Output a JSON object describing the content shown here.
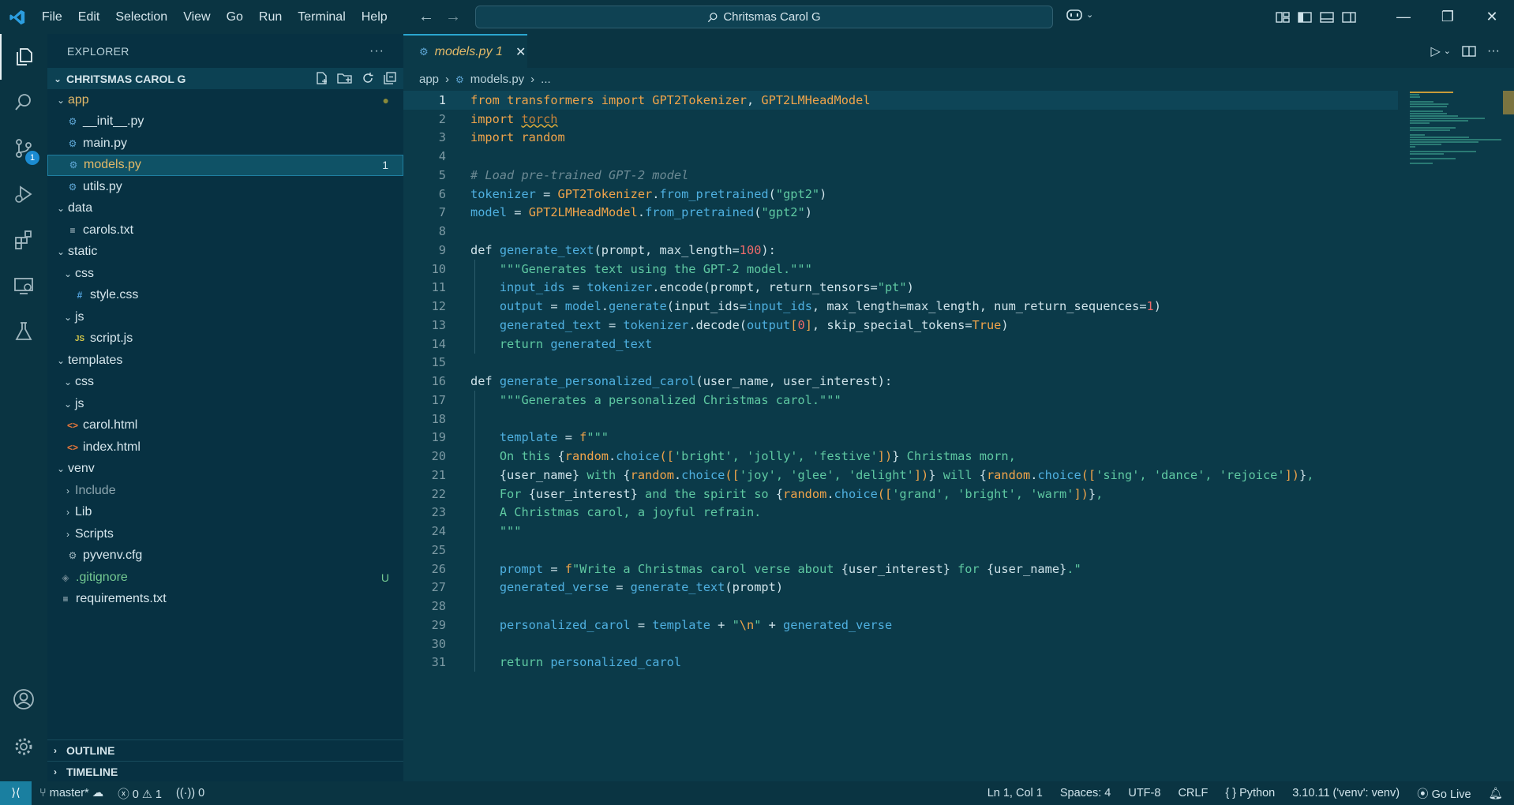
{
  "titlebar": {
    "menu": [
      "File",
      "Edit",
      "Selection",
      "View",
      "Go",
      "Run",
      "Terminal",
      "Help"
    ],
    "search_text": "Chritsmas Carol G"
  },
  "activity": {
    "source_control_badge": "1"
  },
  "sidebar": {
    "title": "EXPLORER",
    "more": "···",
    "section_title": "CHRITSMAS CAROL G",
    "tree": [
      {
        "label": "app",
        "type": "folder",
        "open": true,
        "depth": 0,
        "deco": "●",
        "decoColor": "#8a8a3a",
        "labelColor": "#e3b968"
      },
      {
        "label": "__init__.py",
        "type": "py",
        "depth": 1
      },
      {
        "label": "main.py",
        "type": "py",
        "depth": 1
      },
      {
        "label": "models.py",
        "type": "py",
        "depth": 1,
        "selected": true,
        "deco": "1",
        "labelColor": "#e3b968"
      },
      {
        "label": "utils.py",
        "type": "py",
        "depth": 1
      },
      {
        "label": "data",
        "type": "folder",
        "open": true,
        "depth": 0
      },
      {
        "label": "carols.txt",
        "type": "txt",
        "depth": 1
      },
      {
        "label": "static",
        "type": "folder",
        "open": true,
        "depth": 0
      },
      {
        "label": "css",
        "type": "folder",
        "open": true,
        "depth": 1
      },
      {
        "label": "style.css",
        "type": "css",
        "depth": 2
      },
      {
        "label": "js",
        "type": "folder",
        "open": true,
        "depth": 1
      },
      {
        "label": "script.js",
        "type": "js",
        "depth": 2
      },
      {
        "label": "templates",
        "type": "folder",
        "open": true,
        "depth": 0
      },
      {
        "label": "css",
        "type": "folder",
        "open": true,
        "depth": 1
      },
      {
        "label": "js",
        "type": "folder",
        "open": true,
        "depth": 1
      },
      {
        "label": "carol.html",
        "type": "html",
        "depth": 1
      },
      {
        "label": "index.html",
        "type": "html",
        "depth": 1
      },
      {
        "label": "venv",
        "type": "folder",
        "open": true,
        "depth": 0
      },
      {
        "label": "Include",
        "type": "folder",
        "open": false,
        "depth": 1,
        "labelColor": "#8ea7b0"
      },
      {
        "label": "Lib",
        "type": "folder",
        "open": false,
        "depth": 1
      },
      {
        "label": "Scripts",
        "type": "folder",
        "open": false,
        "depth": 1
      },
      {
        "label": "pyvenv.cfg",
        "type": "cfg",
        "depth": 1
      },
      {
        "label": ".gitignore",
        "type": "git",
        "depth": 0,
        "deco": "U",
        "decoColor": "#73c991",
        "labelColor": "#73c991"
      },
      {
        "label": "requirements.txt",
        "type": "txt",
        "depth": 0
      }
    ],
    "outline": "OUTLINE",
    "timeline": "TIMELINE"
  },
  "editor": {
    "tab_name": "models.py",
    "tab_problems": "1",
    "breadcrumb": [
      "app",
      "models.py",
      "..."
    ],
    "lines": [
      [
        [
          "kw",
          "from "
        ],
        [
          "cls",
          "transformers "
        ],
        [
          "kw",
          "import "
        ],
        [
          "cls",
          "GPT2Tokenizer"
        ],
        [
          "pl",
          ", "
        ],
        [
          "cls",
          "GPT2LMHeadModel"
        ]
      ],
      [
        [
          "kw",
          "import "
        ],
        [
          "squig",
          "torch"
        ]
      ],
      [
        [
          "kw",
          "import "
        ],
        [
          "cls",
          "random"
        ]
      ],
      [],
      [
        [
          "cm",
          "# Load pre-trained GPT-2 model"
        ]
      ],
      [
        [
          "var",
          "tokenizer "
        ],
        [
          "pl",
          "= "
        ],
        [
          "cls",
          "GPT2Tokenizer"
        ],
        [
          "pl",
          "."
        ],
        [
          "fn",
          "from_pretrained"
        ],
        [
          "pl",
          "("
        ],
        [
          "str",
          "\"gpt2\""
        ],
        [
          "pl",
          ")"
        ]
      ],
      [
        [
          "var",
          "model "
        ],
        [
          "pl",
          "= "
        ],
        [
          "cls",
          "GPT2LMHeadModel"
        ],
        [
          "pl",
          "."
        ],
        [
          "fn",
          "from_pretrained"
        ],
        [
          "pl",
          "("
        ],
        [
          "str",
          "\"gpt2\""
        ],
        [
          "pl",
          ")"
        ]
      ],
      [],
      [
        [
          "pl",
          "def "
        ],
        [
          "fn",
          "generate_text"
        ],
        [
          "pl",
          "(prompt, max_length="
        ],
        [
          "num",
          "100"
        ],
        [
          "pl",
          "):"
        ]
      ],
      [
        [
          "pl",
          "    "
        ],
        [
          "str",
          "\"\"\"Generates text using the GPT-2 model.\"\"\""
        ]
      ],
      [
        [
          "pl",
          "    "
        ],
        [
          "var",
          "input_ids "
        ],
        [
          "pl",
          "= "
        ],
        [
          "var",
          "tokenizer"
        ],
        [
          "pl",
          ".encode(prompt, return_tensors="
        ],
        [
          "str",
          "\"pt\""
        ],
        [
          "pl",
          ")"
        ]
      ],
      [
        [
          "pl",
          "    "
        ],
        [
          "var",
          "output "
        ],
        [
          "pl",
          "= "
        ],
        [
          "var",
          "model"
        ],
        [
          "pl",
          "."
        ],
        [
          "fn",
          "generate"
        ],
        [
          "pl",
          "(input_ids="
        ],
        [
          "var",
          "input_ids"
        ],
        [
          "pl",
          ", max_length=max_length, num_return_sequences="
        ],
        [
          "num",
          "1"
        ],
        [
          "pl",
          ")"
        ]
      ],
      [
        [
          "pl",
          "    "
        ],
        [
          "var",
          "generated_text "
        ],
        [
          "pl",
          "= "
        ],
        [
          "var",
          "tokenizer"
        ],
        [
          "pl",
          ".decode("
        ],
        [
          "var",
          "output"
        ],
        [
          "kw",
          "["
        ],
        [
          "num",
          "0"
        ],
        [
          "kw",
          "]"
        ],
        [
          "pl",
          ", skip_special_tokens="
        ],
        [
          "kw",
          "True"
        ],
        [
          "pl",
          ")"
        ]
      ],
      [
        [
          "pl",
          "    "
        ],
        [
          "str",
          "return "
        ],
        [
          "var",
          "generated_text"
        ]
      ],
      [],
      [
        [
          "pl",
          "def "
        ],
        [
          "fn",
          "generate_personalized_carol"
        ],
        [
          "pl",
          "(user_name, user_interest):"
        ]
      ],
      [
        [
          "pl",
          "    "
        ],
        [
          "str",
          "\"\"\"Generates a personalized Christmas carol.\"\"\""
        ]
      ],
      [],
      [
        [
          "pl",
          "    "
        ],
        [
          "var",
          "template "
        ],
        [
          "pl",
          "= "
        ],
        [
          "kw",
          "f"
        ],
        [
          "str",
          "\"\"\""
        ]
      ],
      [
        [
          "pl",
          "    "
        ],
        [
          "str",
          "On this "
        ],
        [
          "pl",
          "{"
        ],
        [
          "kw",
          "random"
        ],
        [
          "pl",
          "."
        ],
        [
          "fn",
          "choice"
        ],
        [
          "kw",
          "(["
        ],
        [
          "str",
          "'bright', 'jolly', 'festive'"
        ],
        [
          "kw",
          "])"
        ],
        [
          "pl",
          "}"
        ],
        [
          "str",
          " Christmas morn,"
        ]
      ],
      [
        [
          "pl",
          "    {user_name}"
        ],
        [
          "str",
          " with "
        ],
        [
          "pl",
          "{"
        ],
        [
          "kw",
          "random"
        ],
        [
          "pl",
          "."
        ],
        [
          "fn",
          "choice"
        ],
        [
          "kw",
          "(["
        ],
        [
          "str",
          "'joy', 'glee', 'delight'"
        ],
        [
          "kw",
          "])"
        ],
        [
          "pl",
          "}"
        ],
        [
          "str",
          " will "
        ],
        [
          "pl",
          "{"
        ],
        [
          "kw",
          "random"
        ],
        [
          "pl",
          "."
        ],
        [
          "fn",
          "choice"
        ],
        [
          "kw",
          "(["
        ],
        [
          "str",
          "'sing', 'dance', 'rejoice'"
        ],
        [
          "kw",
          "])"
        ],
        [
          "pl",
          "}"
        ],
        [
          "str",
          ","
        ]
      ],
      [
        [
          "pl",
          "    "
        ],
        [
          "str",
          "For "
        ],
        [
          "pl",
          "{user_interest}"
        ],
        [
          "str",
          " and the spirit so "
        ],
        [
          "pl",
          "{"
        ],
        [
          "kw",
          "random"
        ],
        [
          "pl",
          "."
        ],
        [
          "fn",
          "choice"
        ],
        [
          "kw",
          "(["
        ],
        [
          "str",
          "'grand', 'bright', 'warm'"
        ],
        [
          "kw",
          "])"
        ],
        [
          "pl",
          "}"
        ],
        [
          "str",
          ","
        ]
      ],
      [
        [
          "pl",
          "    "
        ],
        [
          "str",
          "A Christmas carol, a joyful refrain."
        ]
      ],
      [
        [
          "pl",
          "    "
        ],
        [
          "str",
          "\"\"\""
        ]
      ],
      [],
      [
        [
          "pl",
          "    "
        ],
        [
          "var",
          "prompt "
        ],
        [
          "pl",
          "= "
        ],
        [
          "kw",
          "f"
        ],
        [
          "str",
          "\"Write a Christmas carol verse about "
        ],
        [
          "pl",
          "{user_interest}"
        ],
        [
          "str",
          " for "
        ],
        [
          "pl",
          "{user_name}"
        ],
        [
          "str",
          ".\""
        ]
      ],
      [
        [
          "pl",
          "    "
        ],
        [
          "var",
          "generated_verse "
        ],
        [
          "pl",
          "= "
        ],
        [
          "fn",
          "generate_text"
        ],
        [
          "pl",
          "(prompt)"
        ]
      ],
      [],
      [
        [
          "pl",
          "    "
        ],
        [
          "var",
          "personalized_carol "
        ],
        [
          "pl",
          "= "
        ],
        [
          "var",
          "template "
        ],
        [
          "pl",
          "+ "
        ],
        [
          "str",
          "\""
        ],
        [
          "kw",
          "\\n"
        ],
        [
          "str",
          "\" "
        ],
        [
          "pl",
          "+ "
        ],
        [
          "var",
          "generated_verse"
        ]
      ],
      [],
      [
        [
          "pl",
          "    "
        ],
        [
          "str",
          "return "
        ],
        [
          "var",
          "personalized_carol"
        ]
      ]
    ]
  },
  "status": {
    "branch": "master*",
    "errors": "0",
    "warnings": "1",
    "ports": "0",
    "position": "Ln 1, Col 1",
    "spaces": "Spaces: 4",
    "encoding": "UTF-8",
    "eol": "CRLF",
    "language": "Python",
    "interpreter": "3.10.11 ('venv': venv)",
    "golive": "Go Live"
  }
}
